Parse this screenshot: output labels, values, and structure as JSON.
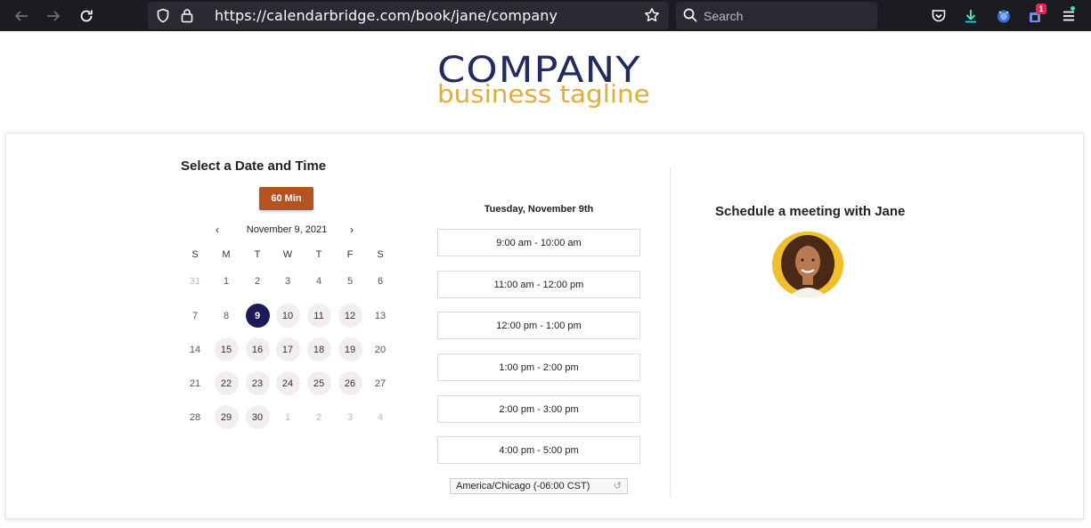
{
  "browser": {
    "url": "https://calendarbridge.com/book/jane/company",
    "search_placeholder": "Search",
    "extension_badge": "1"
  },
  "brand": {
    "name": "COMPANY",
    "tagline": "business tagline"
  },
  "booking": {
    "title": "Select a Date and Time",
    "duration_label": "60 Min",
    "month_label": "November 9, 2021",
    "prev_label": "‹",
    "next_label": "›",
    "weekdays": [
      "S",
      "M",
      "T",
      "W",
      "T",
      "F",
      "S"
    ],
    "weeks": [
      [
        {
          "d": "31",
          "s": "muted"
        },
        {
          "d": "1",
          "s": "plain"
        },
        {
          "d": "2",
          "s": "plain"
        },
        {
          "d": "3",
          "s": "plain"
        },
        {
          "d": "4",
          "s": "plain"
        },
        {
          "d": "5",
          "s": "plain"
        },
        {
          "d": "6",
          "s": "plain"
        }
      ],
      [
        {
          "d": "7",
          "s": "plain"
        },
        {
          "d": "8",
          "s": "plain"
        },
        {
          "d": "9",
          "s": "selected"
        },
        {
          "d": "10",
          "s": "avail"
        },
        {
          "d": "11",
          "s": "avail"
        },
        {
          "d": "12",
          "s": "avail"
        },
        {
          "d": "13",
          "s": "plain"
        }
      ],
      [
        {
          "d": "14",
          "s": "plain"
        },
        {
          "d": "15",
          "s": "avail"
        },
        {
          "d": "16",
          "s": "avail"
        },
        {
          "d": "17",
          "s": "avail"
        },
        {
          "d": "18",
          "s": "avail"
        },
        {
          "d": "19",
          "s": "avail"
        },
        {
          "d": "20",
          "s": "plain"
        }
      ],
      [
        {
          "d": "21",
          "s": "plain"
        },
        {
          "d": "22",
          "s": "avail"
        },
        {
          "d": "23",
          "s": "avail"
        },
        {
          "d": "24",
          "s": "avail"
        },
        {
          "d": "25",
          "s": "avail"
        },
        {
          "d": "26",
          "s": "avail"
        },
        {
          "d": "27",
          "s": "plain"
        }
      ],
      [
        {
          "d": "28",
          "s": "plain"
        },
        {
          "d": "29",
          "s": "avail"
        },
        {
          "d": "30",
          "s": "avail"
        },
        {
          "d": "1",
          "s": "muted"
        },
        {
          "d": "2",
          "s": "muted"
        },
        {
          "d": "3",
          "s": "muted"
        },
        {
          "d": "4",
          "s": "muted"
        }
      ]
    ],
    "selected_date_label": "Tuesday, November 9th",
    "time_slots": [
      "9:00 am - 10:00 am",
      "11:00 am - 12:00 pm",
      "12:00 pm - 1:00 pm",
      "1:00 pm - 2:00 pm",
      "2:00 pm - 3:00 pm",
      "4:00 pm - 5:00 pm"
    ],
    "timezone": "America/Chicago (-06:00 CST)",
    "timezone_reset_icon": "↺",
    "meeting_title": "Schedule a meeting with Jane"
  },
  "colors": {
    "brand_navy": "#232b5e",
    "brand_gold": "#e2ac3b",
    "accent": "#b4531f",
    "selected_day": "#1d1a5a"
  }
}
